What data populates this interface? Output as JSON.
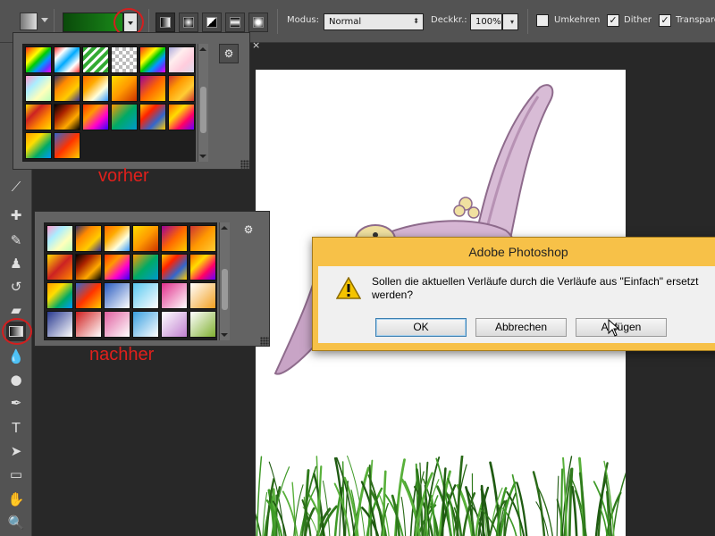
{
  "options_bar": {
    "tool_preset_icon": "gradient-tool-icon",
    "gradient_preview_colors": [
      "#0a4a0a",
      "#1a8a1a"
    ],
    "gradient_types": [
      "linear",
      "radial",
      "angle",
      "reflected",
      "diamond"
    ],
    "mode_label": "Modus:",
    "mode_value": "Normal",
    "opacity_label": "Deckkr.:",
    "opacity_value": "100%",
    "reverse": {
      "label": "Umkehren",
      "checked": false
    },
    "dither": {
      "label": "Dither",
      "checked": true
    },
    "transparency": {
      "label": "Transparenz",
      "checked": true
    },
    "check_mark": "✓",
    "dropdown_glyph": "⬍"
  },
  "document": {
    "close_glyph": "×"
  },
  "picker_before": {
    "label": "vorher",
    "gear_icon": "⚙",
    "swatches": [
      "linear-gradient(135deg,#f22,#f90,#ff0,#0c0,#09f,#63f,#f0f)",
      "linear-gradient(135deg,#f33,#fff 25%,#0af 50%,#fff 75%,#f33)",
      "repeating-linear-gradient(135deg,#3a3 0 4px,#fff 4px 7px)",
      "repeating-conic-gradient(#bbb 0 25%,#fff 0 50%) 0 0/8px 8px",
      "linear-gradient(135deg,#f33,#f90,#ff0,#0c0,#09f,#63f,#f0f)",
      "linear-gradient(135deg,#aad,#fee,#fcd,#dde)",
      "linear-gradient(135deg,#f9c,#aef,#ffb,#bfb)",
      "linear-gradient(135deg,#336,#f80,#fc0,#339)",
      "linear-gradient(135deg,#f60,#fa0,#ffd,#39f)",
      "linear-gradient(135deg,#fd0,#f90,#c30)",
      "linear-gradient(135deg,#909,#f60,#fc0)",
      "linear-gradient(135deg,#c33,#f90,#fc3,#c33)",
      "linear-gradient(135deg,#fd0,#c22,#f80,#fd0)",
      "linear-gradient(135deg,#000,#a20,#fa0,#000)",
      "linear-gradient(135deg,#f30,#f90,#f0c,#30f)",
      "linear-gradient(135deg,#f90,#0a6,#09c)",
      "linear-gradient(135deg,#fc0,#f20,#36c,#fc0)",
      "linear-gradient(135deg,#f60,#fd0,#f06,#60f)",
      "linear-gradient(135deg,#f90,#fd0,#0a6,#09f)",
      "linear-gradient(135deg,#36c,#f30,#fc0)"
    ]
  },
  "picker_after": {
    "label": "nachher",
    "gear_icon": "⚙",
    "swatches": [
      "linear-gradient(135deg,#f9c,#aef,#ffb,#bfb)",
      "linear-gradient(135deg,#336,#f80,#fc0,#339)",
      "linear-gradient(135deg,#f60,#fa0,#ffd,#39f)",
      "linear-gradient(135deg,#fd0,#f90,#c30)",
      "linear-gradient(135deg,#909,#f60,#fc0)",
      "linear-gradient(135deg,#c33,#f90,#fc3)",
      "linear-gradient(135deg,#fd0,#c22,#f80)",
      "linear-gradient(135deg,#000,#a20,#fa0,#000)",
      "linear-gradient(135deg,#f30,#f90,#f0c,#30f)",
      "linear-gradient(135deg,#f90,#0a6,#09c)",
      "linear-gradient(135deg,#fc0,#f20,#36c,#fc0)",
      "linear-gradient(135deg,#f60,#fd0,#f06,#60f)",
      "linear-gradient(135deg,#f90,#fd0,#0a6,#09f)",
      "linear-gradient(135deg,#36c,#f30,#fc0)",
      "linear-gradient(135deg,#2a5cc0,#fff)",
      "linear-gradient(135deg,#5ac8f0,#fff)",
      "linear-gradient(135deg,#e0308c,#fff)",
      "linear-gradient(135deg,#fff,#f2a020)",
      "linear-gradient(135deg,#2a3a90,#fff)",
      "linear-gradient(135deg,#d02020,#fff)",
      "linear-gradient(135deg,#e060a0,#fff)",
      "linear-gradient(135deg,#3aa0e0,#fff)",
      "linear-gradient(135deg,#fff,#c080d0)",
      "linear-gradient(135deg,#fff,#80b030)"
    ]
  },
  "dialog": {
    "title": "Adobe Photoshop",
    "message": "Sollen die aktuellen Verläufe durch die Verläufe aus \"Einfach\" ersetzt werden?",
    "icon": "warning-icon",
    "buttons": {
      "ok": "OK",
      "cancel": "Abbrechen",
      "append": "Anfügen"
    }
  },
  "tools": [
    {
      "name": "eyedropper-tool",
      "glyph": "⟋"
    },
    {
      "name": "healing-brush-tool",
      "glyph": "✚"
    },
    {
      "name": "brush-tool",
      "glyph": "✎"
    },
    {
      "name": "clone-stamp-tool",
      "glyph": "♟"
    },
    {
      "name": "history-brush-tool",
      "glyph": "↺"
    },
    {
      "name": "eraser-tool",
      "glyph": "▰"
    },
    {
      "name": "gradient-tool",
      "glyph": ""
    },
    {
      "name": "blur-tool",
      "glyph": "💧"
    },
    {
      "name": "dodge-tool",
      "glyph": "●"
    },
    {
      "name": "pen-tool",
      "glyph": "✒"
    },
    {
      "name": "type-tool",
      "glyph": "T"
    },
    {
      "name": "path-selection-tool",
      "glyph": "➤"
    },
    {
      "name": "rectangle-tool",
      "glyph": "▭"
    },
    {
      "name": "hand-tool",
      "glyph": "✋"
    },
    {
      "name": "zoom-tool",
      "glyph": "🔍"
    }
  ]
}
